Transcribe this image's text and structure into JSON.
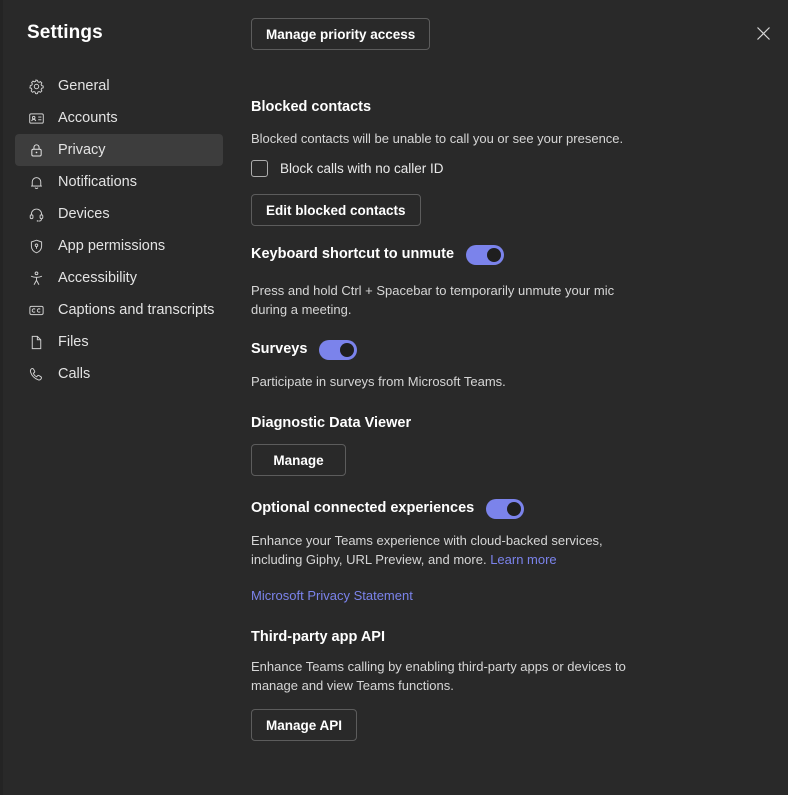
{
  "dialog": {
    "title": "Settings",
    "close_label": "Close",
    "close_icon": "close-icon"
  },
  "sidebar": {
    "items": [
      {
        "label": "General",
        "icon": "gear-icon",
        "active": false
      },
      {
        "label": "Accounts",
        "icon": "contact-card-icon",
        "active": false
      },
      {
        "label": "Privacy",
        "icon": "lock-icon",
        "active": true
      },
      {
        "label": "Notifications",
        "icon": "bell-icon",
        "active": false
      },
      {
        "label": "Devices",
        "icon": "headset-icon",
        "active": false
      },
      {
        "label": "App permissions",
        "icon": "shield-icon",
        "active": false
      },
      {
        "label": "Accessibility",
        "icon": "accessibility-icon",
        "active": false
      },
      {
        "label": "Captions and transcripts",
        "icon": "closed-caption-icon",
        "active": false
      },
      {
        "label": "Files",
        "icon": "file-icon",
        "active": false
      },
      {
        "label": "Calls",
        "icon": "phone-icon",
        "active": false
      }
    ]
  },
  "main": {
    "priority_access_button": "Manage priority access",
    "blocked_contacts": {
      "title": "Blocked contacts",
      "description": "Blocked contacts will be unable to call you or see your presence.",
      "checkbox_label": "Block calls with no caller ID",
      "checkbox_checked": false,
      "edit_button": "Edit blocked contacts"
    },
    "keyboard_shortcut": {
      "title": "Keyboard shortcut to unmute",
      "toggle_on": true,
      "description": "Press and hold Ctrl + Spacebar to temporarily unmute your mic during a meeting."
    },
    "surveys": {
      "title": "Surveys",
      "toggle_on": true,
      "description": "Participate in surveys from Microsoft Teams."
    },
    "diagnostic": {
      "title": "Diagnostic Data Viewer",
      "manage_button": "Manage"
    },
    "optional_experiences": {
      "title": "Optional connected experiences",
      "toggle_on": true,
      "description": "Enhance your Teams experience with cloud-backed services, including Giphy, URL Preview, and more.",
      "learn_more": "Learn more",
      "privacy_statement": "Microsoft Privacy Statement"
    },
    "third_party": {
      "title": "Third-party app API",
      "description": "Enhance Teams calling by enabling third-party apps or devices to manage and view Teams functions.",
      "manage_button": "Manage API"
    }
  },
  "colors": {
    "accent": "#7b83eb",
    "background": "#292929",
    "active_item": "#3d3d3d"
  }
}
